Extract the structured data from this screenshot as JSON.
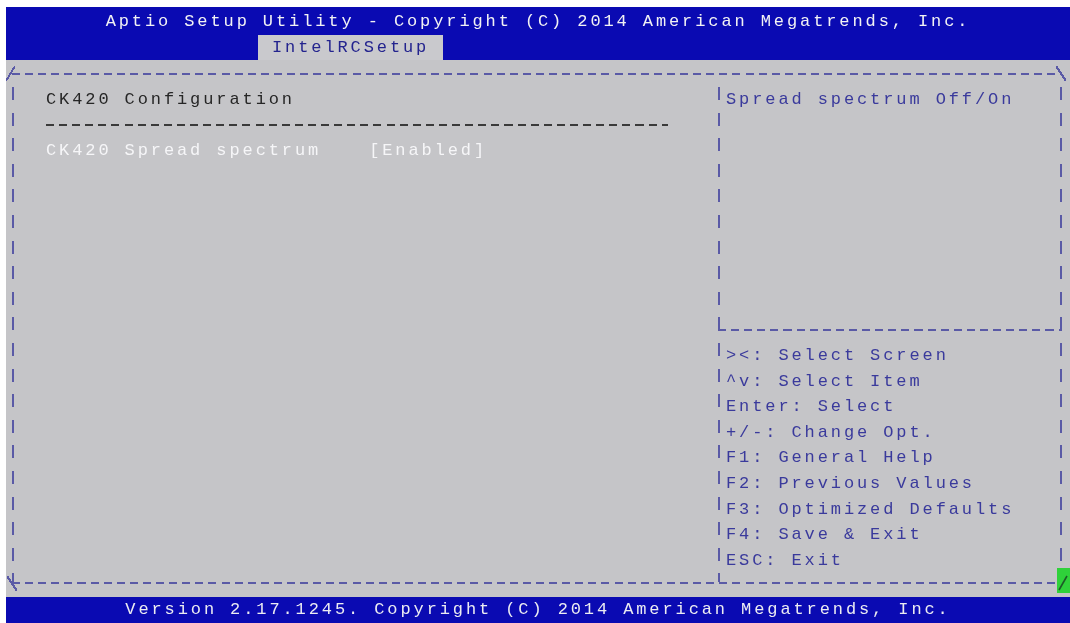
{
  "header": {
    "title": "Aptio Setup Utility - Copyright (C) 2014 American Megatrends, Inc.",
    "tabs": [
      {
        "label": "IntelRCSetup",
        "selected": true
      }
    ]
  },
  "main_panel": {
    "heading": "CK420 Configuration",
    "items": [
      {
        "label": "CK420 Spread spectrum",
        "value": "[Enabled]",
        "selected": true
      }
    ]
  },
  "help_panel": {
    "description": "Spread spectrum Off/On",
    "key_hints": [
      "><: Select Screen",
      "^v: Select Item",
      "Enter: Select",
      "+/-: Change Opt.",
      "F1: General Help",
      "F2: Previous Values",
      "F3: Optimized Defaults",
      "F4: Save & Exit",
      "ESC: Exit"
    ]
  },
  "footer": {
    "version": "Version 2.17.1245. Copyright (C) 2014 American Megatrends, Inc."
  }
}
